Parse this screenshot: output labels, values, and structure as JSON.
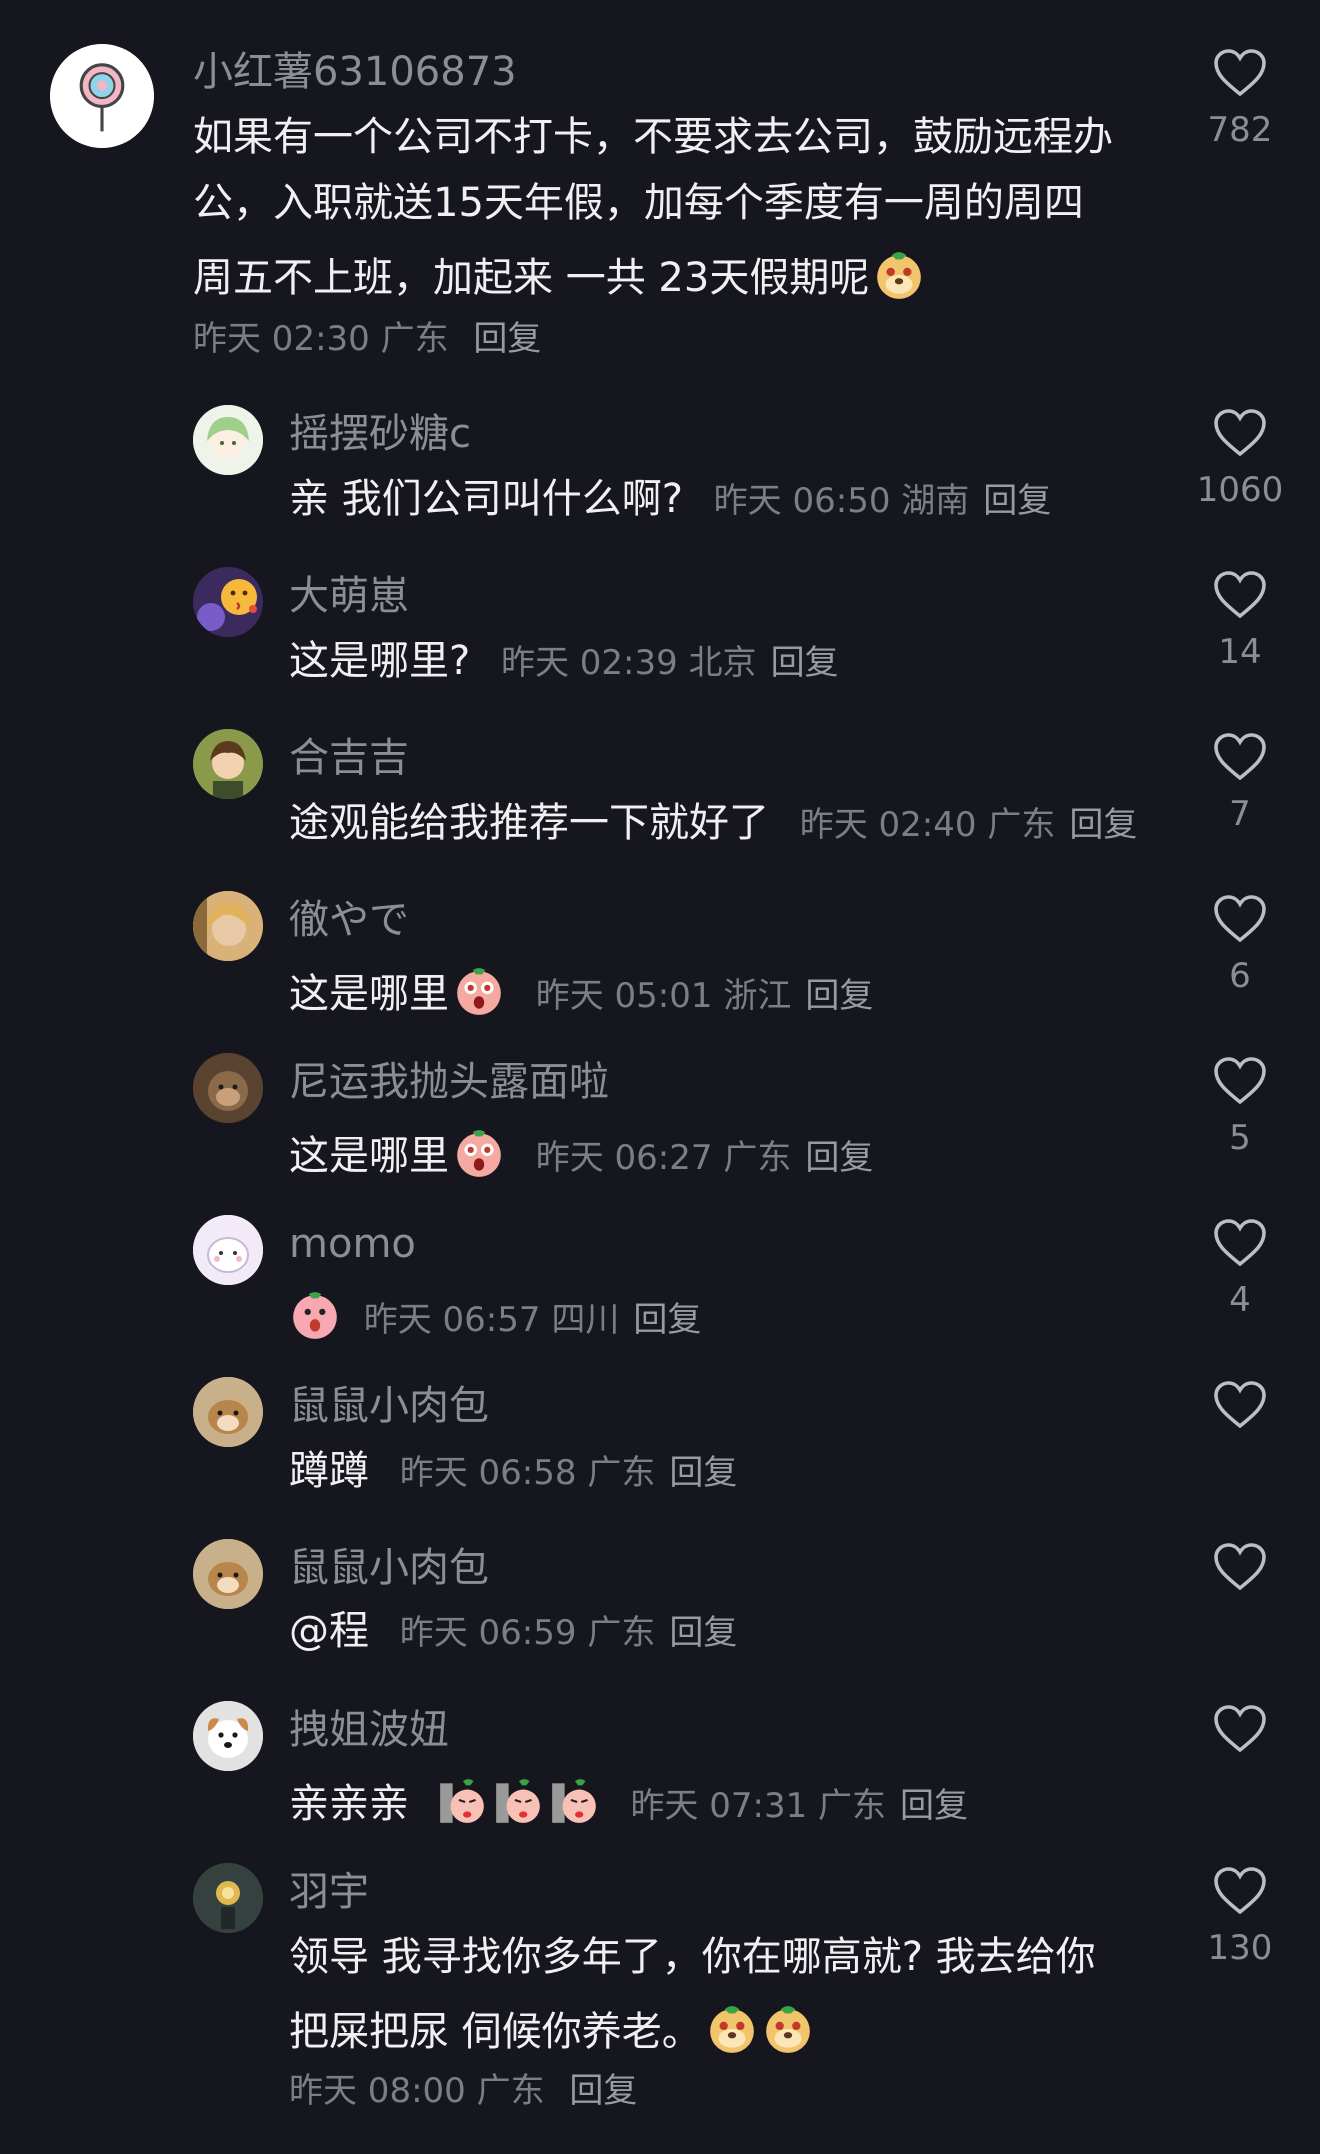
{
  "main_comment": {
    "username": "小红薯63106873",
    "text_lines": [
      "如果有一个公司不打卡，不要求去公司，鼓励远程办",
      "公，入职就送15天年假，加每个季度有一周的周四",
      "周五不上班，加起来 一共 23天假期呢"
    ],
    "time": "昨天 02:30",
    "location": "广东",
    "reply_label": "回复",
    "likes": "782"
  },
  "replies": [
    {
      "username": "摇摆砂糖c",
      "text": "亲 我们公司叫什么啊?",
      "time": "昨天 06:50",
      "location": "湖南",
      "reply_label": "回复",
      "likes": "1060"
    },
    {
      "username": "大萌崽",
      "text": "这是哪里?",
      "time": "昨天 02:39",
      "location": "北京",
      "reply_label": "回复",
      "likes": "14"
    },
    {
      "username": "合吉吉",
      "text": "途观能给我推荐一下就好了",
      "time": "昨天 02:40",
      "location": "广东",
      "reply_label": "回复",
      "likes": "7"
    },
    {
      "username": "徹やで",
      "text": "这是哪里",
      "time": "昨天 05:01",
      "location": "浙江",
      "reply_label": "回复",
      "likes": "6"
    },
    {
      "username": "尼运我抛头露面啦",
      "text": "这是哪里",
      "time": "昨天 06:27",
      "location": "广东",
      "reply_label": "回复",
      "likes": "5"
    },
    {
      "username": "momo",
      "text": "",
      "time": "昨天 06:57",
      "location": "四川",
      "reply_label": "回复",
      "likes": "4"
    },
    {
      "username": "鼠鼠小肉包",
      "text": "蹲蹲",
      "time": "昨天 06:58",
      "location": "广东",
      "reply_label": "回复",
      "likes": ""
    },
    {
      "username": "鼠鼠小肉包",
      "text": "@程",
      "time": "昨天 06:59",
      "location": "广东",
      "reply_label": "回复",
      "likes": ""
    },
    {
      "username": "拽姐波妞",
      "text": "亲亲亲",
      "time": "昨天 07:31",
      "location": "广东",
      "reply_label": "回复",
      "likes": ""
    },
    {
      "username": "羽宇",
      "text_lines": [
        "领导 我寻找你多年了，你在哪高就? 我去给你",
        "把屎把尿 伺候你养老。"
      ],
      "time": "昨天 08:00",
      "location": "广东",
      "reply_label": "回复",
      "likes": "130"
    }
  ],
  "icons": {
    "like": "heart-outline-icon"
  },
  "colors": {
    "background": "#16161e",
    "text": "#f0f0f3",
    "muted": "#8d8d96"
  }
}
